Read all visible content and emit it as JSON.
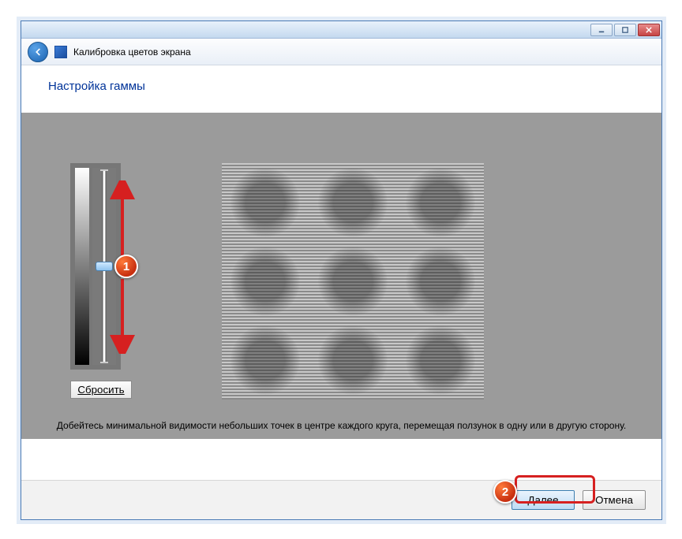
{
  "window": {
    "nav_title": "Калибровка цветов экрана"
  },
  "heading": "Настройка гаммы",
  "reset_label": "Сбросить",
  "instruction": "Добейтесь минимальной видимости небольших точек в центре каждого круга, перемещая ползунок в одну или в другую сторону.",
  "buttons": {
    "next": "Далее",
    "cancel": "Отмена"
  },
  "markers": {
    "m1": "1",
    "m2": "2"
  }
}
